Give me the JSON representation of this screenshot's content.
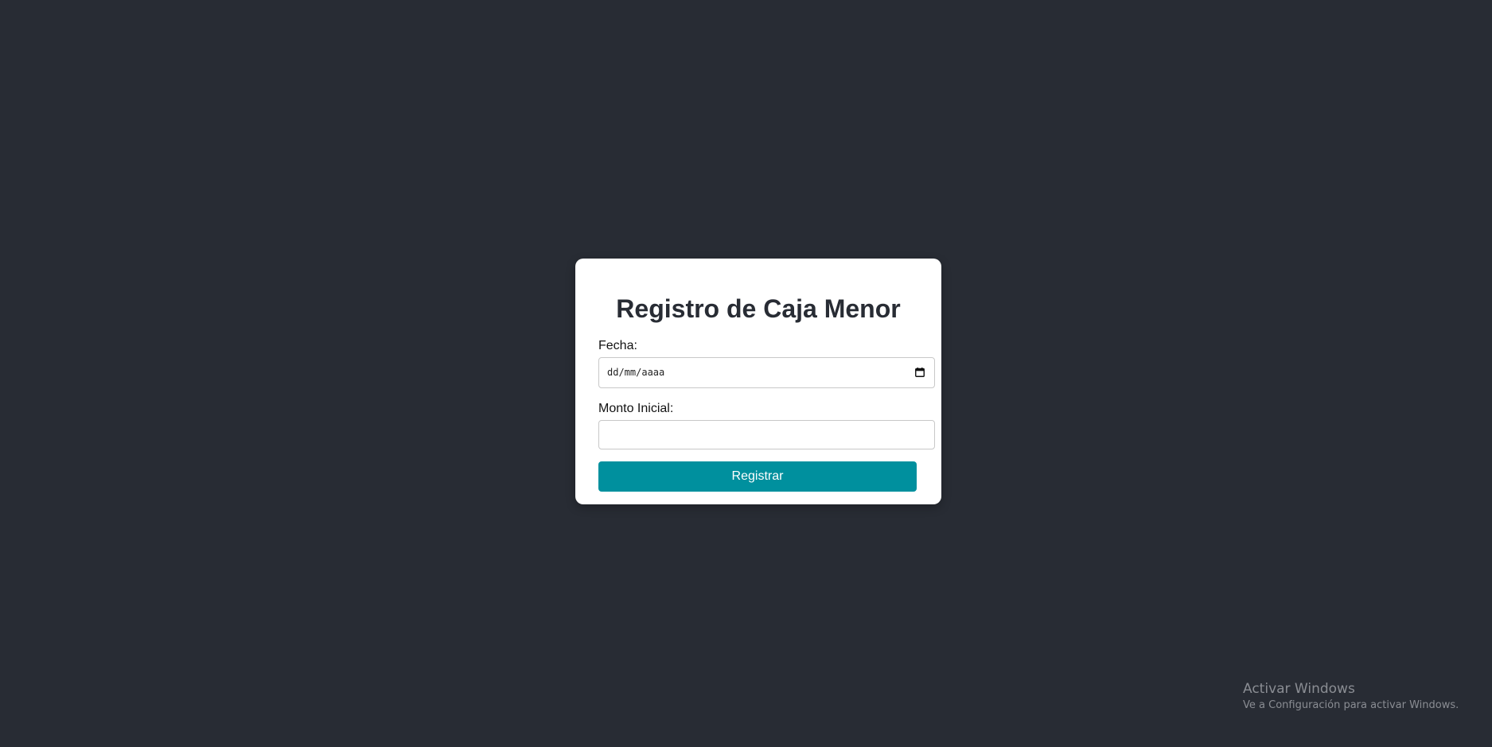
{
  "form": {
    "title": "Registro de Caja Menor",
    "fecha_label": "Fecha:",
    "fecha_placeholder": "dd/mm/aaaa",
    "monto_label": "Monto Inicial:",
    "monto_value": "",
    "submit_label": "Registrar"
  },
  "watermark": {
    "title": "Activar Windows",
    "subtitle": "Ve a Configuración para activar Windows."
  },
  "colors": {
    "background": "#282c34",
    "card": "#ffffff",
    "accent": "#00909e"
  },
  "icons": {
    "date_picker": "calendar-icon"
  }
}
